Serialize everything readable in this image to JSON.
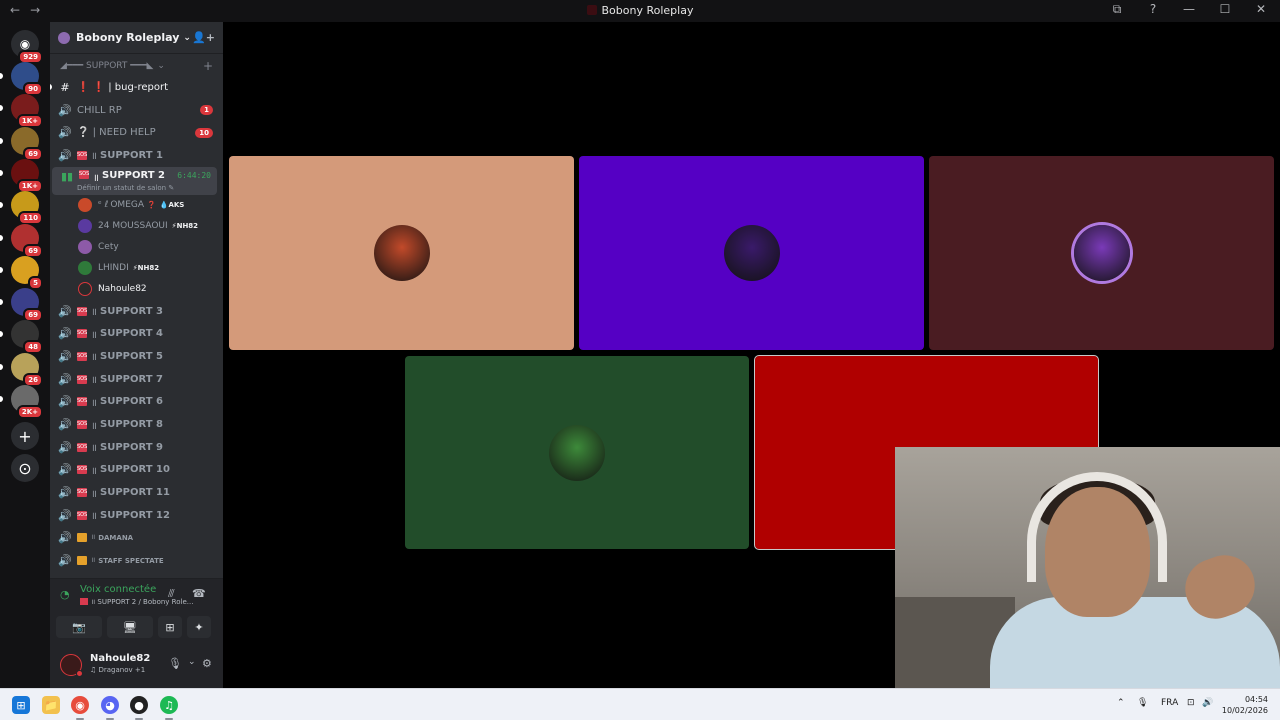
{
  "window": {
    "title": "Bobony Roleplay",
    "nav": {
      "back": "←",
      "forward": "→"
    },
    "controls": {
      "pip": "⧉",
      "help": "?",
      "minimize": "—",
      "maximize": "☐",
      "close": "✕"
    }
  },
  "rail": {
    "home_badge": "929",
    "servers": [
      {
        "badge": "90",
        "color": "#2f4d8a"
      },
      {
        "badge": "1K+",
        "color": "#7a1c1c"
      },
      {
        "badge": "69",
        "color": "#8a6a2a"
      },
      {
        "badge": "1K+",
        "color": "#6a1010"
      },
      {
        "badge": "110",
        "color": "#c79a1a"
      },
      {
        "badge": "69",
        "color": "#b03030"
      },
      {
        "badge": "5",
        "color": "#d9a020"
      },
      {
        "badge": "69",
        "color": "#3a3f8a"
      },
      {
        "badge": "48",
        "color": "#333333"
      },
      {
        "badge": "26",
        "color": "#b8a25a"
      },
      {
        "badge": "2K+",
        "color": "#6a6a6a"
      }
    ],
    "add_icon": "+",
    "discover_icon": "⊙"
  },
  "server": {
    "name": "Bobony Roleplay",
    "chevron": "⌄",
    "invite_icon": "👤+"
  },
  "category": {
    "label": "◢━━━ SUPPORT ━━━◣",
    "collapse": "⌄",
    "add": "+"
  },
  "channels": {
    "bug_report": {
      "icon": "#",
      "label": "❗ ❗ | bug-report"
    },
    "chill_rp": {
      "label": "CHILL RP",
      "count": "1"
    },
    "need_help": {
      "label": "❔ | NEED HELP",
      "count": "10"
    },
    "support1": {
      "label": "SUPPORT 1",
      "prefix": "॥"
    },
    "support2": {
      "label": "SUPPORT 2",
      "prefix": "॥",
      "timer": "6:44:20",
      "status": "Définir un statut de salon ✎"
    },
    "rest": [
      {
        "label": "SUPPORT 3",
        "prefix": "॥"
      },
      {
        "label": "SUPPORT 4",
        "prefix": "॥"
      },
      {
        "label": "SUPPORT 5",
        "prefix": "॥"
      },
      {
        "label": "SUPPORT 7",
        "prefix": "॥"
      },
      {
        "label": "SUPPORT 6",
        "prefix": "॥"
      },
      {
        "label": "SUPPORT 8",
        "prefix": "॥"
      },
      {
        "label": "SUPPORT 9",
        "prefix": "॥"
      },
      {
        "label": "SUPPORT 10",
        "prefix": "॥"
      },
      {
        "label": "SUPPORT 11",
        "prefix": "॥"
      },
      {
        "label": "SUPPORT 12",
        "prefix": "॥"
      }
    ],
    "damana": {
      "label": "DAMANA",
      "prefix": "॥"
    },
    "staff": {
      "label": "STAFF SPECTATE",
      "prefix": "॥"
    }
  },
  "voice_users": [
    {
      "name": "OMEGA",
      "prefix": "ᵉ ℓ",
      "suffix": "❓",
      "tag": "💧AKS",
      "color": "#c94a2a"
    },
    {
      "name": "24 MOUSSAOUI",
      "tag": "⚡NH82",
      "color": "#5a3aa0"
    },
    {
      "name": "Cety",
      "tag": "",
      "color": "#8d5aa8"
    },
    {
      "name": "LHINDI",
      "tag": "⚡NH82",
      "color": "#2f7a3a"
    },
    {
      "name": "Nahoule82",
      "tag": "",
      "color": "#2a2a2a"
    }
  ],
  "voice_panel": {
    "connected": "Voix connectée",
    "channel": "॥ SUPPORT 2 / Bobony Role...",
    "buttons": [
      "📷",
      "🖥",
      "⊞",
      "✦"
    ]
  },
  "user_panel": {
    "name": "Nahoule82",
    "activity": "♫ Draganov +1",
    "mic": "🎙",
    "headset": "🎧",
    "settings": "⚙"
  },
  "tiles": [
    {
      "color": "#d49a7a",
      "avatar": "#c24a2a"
    },
    {
      "color": "#5500c4",
      "avatar": "#3a1a6a"
    },
    {
      "color": "#4a1c22",
      "avatar": "#7a3ab8"
    },
    {
      "color": "#224d2a",
      "avatar": "#3d8a3a"
    },
    {
      "color": "#b00000",
      "avatar": ""
    }
  ],
  "taskbar": {
    "apps": [
      "⊞",
      "📁",
      "◉",
      "◕",
      "●",
      "♫"
    ],
    "tray": {
      "up": "⌃",
      "mic": "🎙",
      "lang": "FRA",
      "monitor": "⊡",
      "volume": "🔊"
    },
    "time": "04:54",
    "date": "10/02/2026"
  }
}
